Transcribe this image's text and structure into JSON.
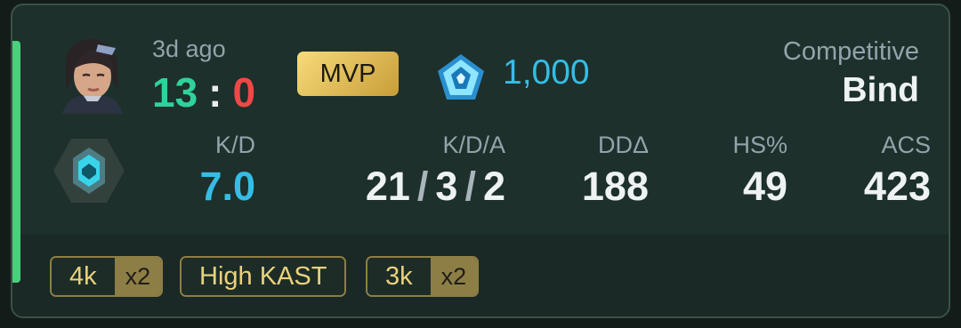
{
  "match": {
    "time_ago": "3d ago",
    "score_team": "13",
    "score_separator": ":",
    "score_enemy": "0",
    "mvp_label": "MVP",
    "rr_value": "1,000",
    "mode": "Competitive",
    "map": "Bind"
  },
  "stats": {
    "kd_label": "K/D",
    "kd_value": "7.0",
    "kda_label": "K/D/A",
    "kills": "21",
    "deaths": "3",
    "assists": "2",
    "kda_sep": "/",
    "dd_label": "DDΔ",
    "dd_value": "188",
    "hs_label": "HS%",
    "hs_value": "49",
    "acs_label": "ACS",
    "acs_value": "423"
  },
  "badges": [
    {
      "label": "4k",
      "multiplier": "x2"
    },
    {
      "label": "High KAST"
    },
    {
      "label": "3k",
      "multiplier": "x2"
    }
  ],
  "icons": {
    "agent": "agent-portrait-icon",
    "rank": "rank-emblem-icon",
    "rr": "rr-crystal-icon"
  },
  "colors": {
    "win": "#2fd29b",
    "loss": "#f04747",
    "accent": "#35bde6",
    "win_bar": "#4ad07c",
    "badge_gold": "#8d7e45"
  }
}
